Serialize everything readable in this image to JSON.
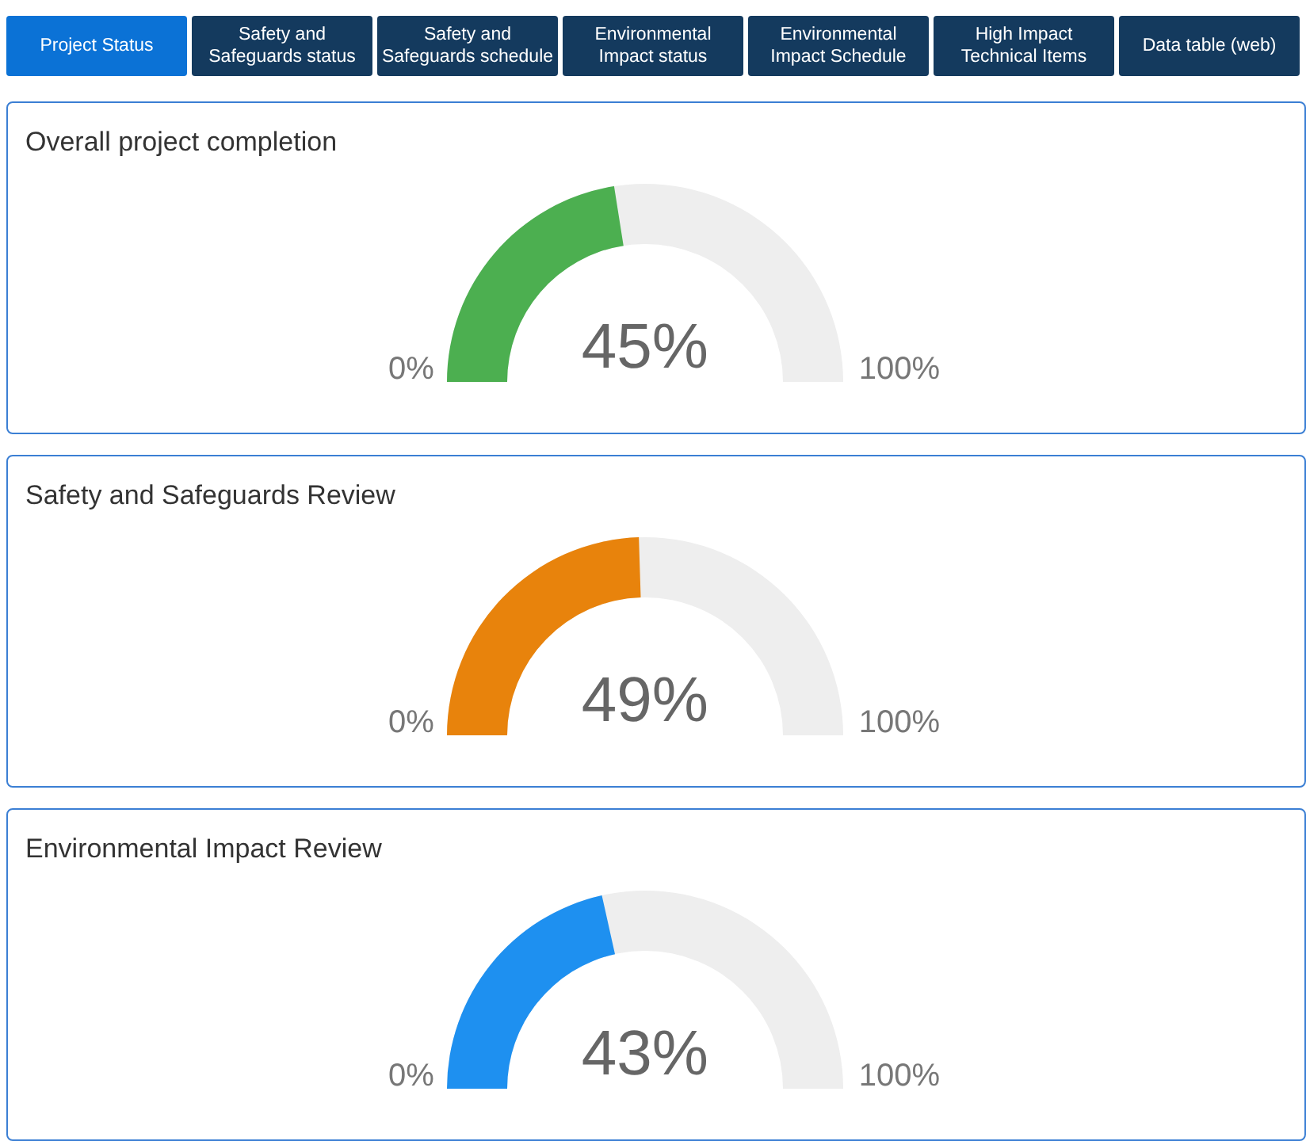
{
  "tabs": [
    {
      "label": "Project Status",
      "selected": true
    },
    {
      "label": "Safety and Safeguards status",
      "selected": false
    },
    {
      "label": "Safety and Safeguards schedule",
      "selected": false
    },
    {
      "label": "Environmental Impact status",
      "selected": false
    },
    {
      "label": "Environmental Impact Schedule",
      "selected": false
    },
    {
      "label": "High Impact Technical Items",
      "selected": false
    },
    {
      "label": "Data table (web)",
      "selected": false
    }
  ],
  "gauges": [
    {
      "title": "Overall project completion",
      "reading": "45%",
      "min_label": "0%",
      "max_label": "100%",
      "color": "#4caf50"
    },
    {
      "title": "Safety and Safeguards Review",
      "reading": "49%",
      "min_label": "0%",
      "max_label": "100%",
      "color": "#e8830c"
    },
    {
      "title": "Environmental Impact Review",
      "reading": "43%",
      "min_label": "0%",
      "max_label": "100%",
      "color": "#1e90f0"
    }
  ]
}
